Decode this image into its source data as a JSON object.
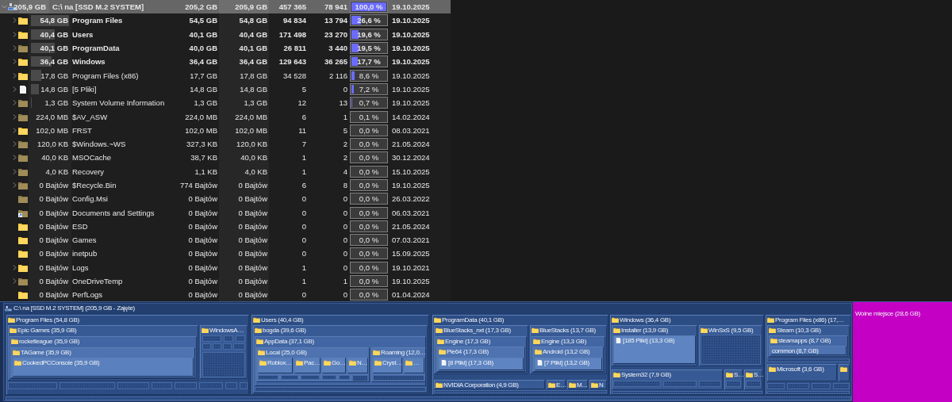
{
  "table": {
    "rows": [
      {
        "selected": true,
        "bold": true,
        "kind": "drive",
        "expandable": true,
        "expanded": true,
        "size_bar": {
          "level": 0
        },
        "percent_bar": {
          "level": 1.0
        },
        "cells": [
          "205,9 GB",
          "C:\\  na  [SSD M.2 SYSTEM]",
          "205,2 GB",
          "205,9 GB",
          "457 365",
          "78 941",
          "100,0 %",
          "19.10.2025"
        ],
        "children": [
          {
            "selected": false,
            "bold": true,
            "kind": "folder",
            "expandable": true,
            "size_bar": {
              "level": 1.0
            },
            "percent_bar": {
              "level": 0.266
            },
            "cells": [
              "54,8 GB",
              "Program Files",
              "54,5 GB",
              "54,8 GB",
              "94 834",
              "13 794",
              "26,6 %",
              "19.10.2025"
            ]
          },
          {
            "selected": false,
            "bold": true,
            "kind": "folder",
            "expandable": true,
            "size_bar": {
              "level": 0.63
            },
            "percent_bar": {
              "level": 0.196
            },
            "cells": [
              "40,4 GB",
              "Users",
              "40,1 GB",
              "40,4 GB",
              "171 498",
              "23 270",
              "19,6 %",
              "19.10.2025"
            ]
          },
          {
            "selected": false,
            "bold": true,
            "kind": "hidden-folder",
            "expandable": true,
            "size_bar": {
              "level": 0.63
            },
            "percent_bar": {
              "level": 0.195
            },
            "cells": [
              "40,1 GB",
              "ProgramData",
              "40,0 GB",
              "40,1 GB",
              "26 811",
              "3 440",
              "19,5 %",
              "19.10.2025"
            ]
          },
          {
            "selected": false,
            "bold": true,
            "kind": "folder",
            "expandable": true,
            "size_bar": {
              "level": 0.55
            },
            "percent_bar": {
              "level": 0.177
            },
            "cells": [
              "36,4 GB",
              "Windows",
              "36,4 GB",
              "36,4 GB",
              "129 643",
              "36 265",
              "17,7 %",
              "19.10.2025"
            ]
          },
          {
            "selected": false,
            "bold": false,
            "kind": "folder",
            "expandable": true,
            "size_bar": {
              "level": 0.28
            },
            "percent_bar": {
              "level": 0.086
            },
            "cells": [
              "17,8 GB",
              "Program Files (x86)",
              "17,7 GB",
              "17,8 GB",
              "34 528",
              "2 116",
              "8,6 %",
              "19.10.2025"
            ]
          },
          {
            "selected": false,
            "bold": false,
            "kind": "file",
            "expandable": true,
            "size_bar": {
              "level": 0.2
            },
            "percent_bar": {
              "level": 0.072
            },
            "cells": [
              "14,8 GB",
              "[5 Pliki]",
              "14,8 GB",
              "14,8 GB",
              "5",
              "0",
              "7,2 %",
              "19.10.2025"
            ]
          },
          {
            "selected": false,
            "bold": false,
            "kind": "hidden-folder",
            "expandable": true,
            "size_bar": {
              "level": 0.03
            },
            "percent_bar": {
              "level": 0.007
            },
            "cells": [
              "1,3 GB",
              "System Volume Information",
              "1,3 GB",
              "1,3 GB",
              "12",
              "13",
              "0,7 %",
              "19.10.2025"
            ]
          },
          {
            "selected": false,
            "bold": false,
            "kind": "hidden-folder",
            "expandable": true,
            "size_bar": {
              "level": 0
            },
            "percent_bar": {
              "level": 0.001
            },
            "cells": [
              "224,0 MB",
              "$AV_ASW",
              "224,0 MB",
              "224,0 MB",
              "6",
              "1",
              "0,1 %",
              "14.02.2024"
            ]
          },
          {
            "selected": false,
            "bold": false,
            "kind": "folder",
            "expandable": true,
            "size_bar": {
              "level": 0
            },
            "percent_bar": {
              "level": 0
            },
            "cells": [
              "102,0 MB",
              "FRST",
              "102,0 MB",
              "102,0 MB",
              "11",
              "5",
              "0,0 %",
              "08.03.2021"
            ]
          },
          {
            "selected": false,
            "bold": false,
            "kind": "hidden-folder",
            "expandable": true,
            "size_bar": {
              "level": 0
            },
            "percent_bar": {
              "level": 0
            },
            "cells": [
              "120,0 KB",
              "$Windows.~WS",
              "327,3 KB",
              "120,0 KB",
              "7",
              "2",
              "0,0 %",
              "21.05.2024"
            ]
          },
          {
            "selected": false,
            "bold": false,
            "kind": "hidden-folder",
            "expandable": true,
            "size_bar": {
              "level": 0
            },
            "percent_bar": {
              "level": 0
            },
            "cells": [
              "40,0 KB",
              "MSOCache",
              "38,7 KB",
              "40,0 KB",
              "1",
              "2",
              "0,0 %",
              "30.12.2024"
            ]
          },
          {
            "selected": false,
            "bold": false,
            "kind": "hidden-folder",
            "expandable": true,
            "size_bar": {
              "level": 0
            },
            "percent_bar": {
              "level": 0
            },
            "cells": [
              "4,0 KB",
              "Recovery",
              "1,1 KB",
              "4,0 KB",
              "1",
              "4",
              "0,0 %",
              "15.10.2025"
            ]
          },
          {
            "selected": false,
            "bold": false,
            "kind": "hidden-folder",
            "expandable": true,
            "size_bar": {
              "level": 0
            },
            "percent_bar": {
              "level": 0
            },
            "cells": [
              "0 Bajtów",
              "$Recycle.Bin",
              "774 Bajtów",
              "0 Bajtów",
              "6",
              "8",
              "0,0 %",
              "19.10.2025"
            ]
          },
          {
            "selected": false,
            "bold": false,
            "kind": "hidden-folder",
            "expandable": false,
            "size_bar": {
              "level": 0
            },
            "percent_bar": {
              "level": 0
            },
            "cells": [
              "0 Bajtów",
              "Config.Msi",
              "0 Bajtów",
              "0 Bajtów",
              "0",
              "0",
              "0,0 %",
              "26.03.2022"
            ]
          },
          {
            "selected": false,
            "bold": false,
            "kind": "link-folder",
            "expandable": false,
            "size_bar": {
              "level": 0
            },
            "percent_bar": {
              "level": 0
            },
            "cells": [
              "0 Bajtów",
              "Documents and Settings",
              "0 Bajtów",
              "0 Bajtów",
              "0",
              "0",
              "0,0 %",
              "06.03.2021"
            ]
          },
          {
            "selected": false,
            "bold": false,
            "kind": "folder",
            "expandable": false,
            "size_bar": {
              "level": 0
            },
            "percent_bar": {
              "level": 0
            },
            "cells": [
              "0 Bajtów",
              "ESD",
              "0 Bajtów",
              "0 Bajtów",
              "0",
              "0",
              "0,0 %",
              "21.05.2024"
            ]
          },
          {
            "selected": false,
            "bold": false,
            "kind": "folder",
            "expandable": false,
            "size_bar": {
              "level": 0
            },
            "percent_bar": {
              "level": 0
            },
            "cells": [
              "0 Bajtów",
              "Games",
              "0 Bajtów",
              "0 Bajtów",
              "0",
              "0",
              "0,0 %",
              "07.03.2021"
            ]
          },
          {
            "selected": false,
            "bold": false,
            "kind": "folder",
            "expandable": false,
            "size_bar": {
              "level": 0
            },
            "percent_bar": {
              "level": 0
            },
            "cells": [
              "0 Bajtów",
              "inetpub",
              "0 Bajtów",
              "0 Bajtów",
              "0",
              "0",
              "0,0 %",
              "15.09.2025"
            ]
          },
          {
            "selected": false,
            "bold": false,
            "kind": "folder",
            "expandable": true,
            "size_bar": {
              "level": 0
            },
            "percent_bar": {
              "level": 0
            },
            "cells": [
              "0 Bajtów",
              "Logs",
              "0 Bajtów",
              "0 Bajtów",
              "1",
              "0",
              "0,0 %",
              "19.10.2021"
            ]
          },
          {
            "selected": false,
            "bold": false,
            "kind": "hidden-folder",
            "expandable": true,
            "size_bar": {
              "level": 0
            },
            "percent_bar": {
              "level": 0
            },
            "cells": [
              "0 Bajtów",
              "OneDriveTemp",
              "0 Bajtów",
              "0 Bajtów",
              "1",
              "1",
              "0,0 %",
              "19.10.2025"
            ]
          },
          {
            "selected": false,
            "bold": false,
            "kind": "folder",
            "expandable": false,
            "size_bar": {
              "level": 0
            },
            "percent_bar": {
              "level": 0
            },
            "cells": [
              "0 Bajtów",
              "PerfLogs",
              "0 Bajtów",
              "0 Bajtów",
              "0",
              "0",
              "0,0 %",
              "01.04.2024"
            ]
          }
        ]
      }
    ]
  },
  "treemap": {
    "title": "C:\\  na  [SSD M.2 SYSTEM] (205,9 GB - Zajęte)",
    "nodes": [
      {
        "kind": "folder",
        "label": "Program Files (54,8 GB)",
        "children": [
          {
            "kind": "folder",
            "label": "Epic Games (35,9 GB)",
            "children": [
              {
                "kind": "folder",
                "label": "rocketleague (35,9 GB)",
                "children": [
                  {
                    "kind": "folder",
                    "label": "TAGame (35,9 GB)",
                    "children": [
                      {
                        "kind": "folder",
                        "label": "CookedPCConsole (35,9 GB)"
                      }
                    ]
                  }
                ]
              }
            ]
          },
          {
            "kind": "folder",
            "label": "WindowsA…"
          }
        ]
      },
      {
        "kind": "folder",
        "label": "Users (40,4 GB)",
        "children": [
          {
            "kind": "folder",
            "label": "bogda (39,6 GB)",
            "children": [
              {
                "kind": "folder",
                "label": "AppData (37,1 GB)",
                "children": [
                  {
                    "kind": "folder",
                    "label": "Local (25,0 GB)",
                    "children": [
                      {
                        "kind": "folder",
                        "label": "Roblox…"
                      },
                      {
                        "kind": "folder",
                        "label": "Pac…"
                      },
                      {
                        "kind": "folder",
                        "label": "Go…"
                      },
                      {
                        "kind": "folder",
                        "label": "N…"
                      }
                    ]
                  },
                  {
                    "kind": "folder",
                    "label": "Roaming (12,0…",
                    "children": [
                      {
                        "kind": "folder",
                        "label": "Cryst…"
                      },
                      {
                        "kind": "folder",
                        "label": "…"
                      }
                    ]
                  }
                ]
              }
            ]
          }
        ]
      },
      {
        "kind": "folder",
        "label": "ProgramData (40,1 GB)",
        "children": [
          {
            "kind": "folder",
            "label": "BlueStacks_nxt (17,3 GB)",
            "children": [
              {
                "kind": "folder",
                "label": "Engine (17,3 GB)",
                "children": [
                  {
                    "kind": "folder",
                    "label": "Pie64 (17,3 GB)",
                    "children": [
                      {
                        "kind": "file",
                        "label": "[8 Pliki] (17,3 GB)"
                      }
                    ]
                  }
                ]
              }
            ]
          },
          {
            "kind": "folder",
            "label": "BlueStacks (13,7 GB)",
            "children": [
              {
                "kind": "folder",
                "label": "Engine (13,3 GB)",
                "children": [
                  {
                    "kind": "folder",
                    "label": "Android (13,2 GB)",
                    "children": [
                      {
                        "kind": "file",
                        "label": "[7 Pliki] (13,2 GB)"
                      }
                    ]
                  }
                ]
              }
            ]
          },
          {
            "kind": "folder",
            "label": "NVIDIA Corporation (4,9 GB)"
          },
          {
            "kind": "folder",
            "label": "E…"
          },
          {
            "kind": "folder",
            "label": "M…"
          },
          {
            "kind": "folder",
            "label": "N"
          }
        ]
      },
      {
        "kind": "folder",
        "label": "Windows (36,4 GB)",
        "children": [
          {
            "kind": "folder",
            "label": "Installer (13,9 GB)",
            "children": [
              {
                "kind": "file",
                "label": "[185 Pliki] (13,3 GB)"
              }
            ]
          },
          {
            "kind": "folder",
            "label": "WinSxS (9,5 GB)"
          },
          {
            "kind": "folder",
            "label": "System32 (7,9 GB)"
          },
          {
            "kind": "folder",
            "label": "S…"
          },
          {
            "kind": "folder",
            "label": "S…"
          }
        ]
      },
      {
        "kind": "folder",
        "label": "Program Files (x86) (17,…",
        "children": [
          {
            "kind": "folder",
            "label": "Steam (10,3 GB)",
            "children": [
              {
                "kind": "folder",
                "label": "steamapps (8,7 GB)",
                "children": [
                  {
                    "kind": "plain",
                    "label": "common (8,7 GB)"
                  }
                ]
              }
            ]
          },
          {
            "kind": "folder",
            "label": "Microsoft (3,6 GB)"
          },
          {
            "kind": "folder"
          }
        ]
      }
    ],
    "free_space": {
      "label": "Wolne miejsce (28,6 GB)"
    }
  }
}
